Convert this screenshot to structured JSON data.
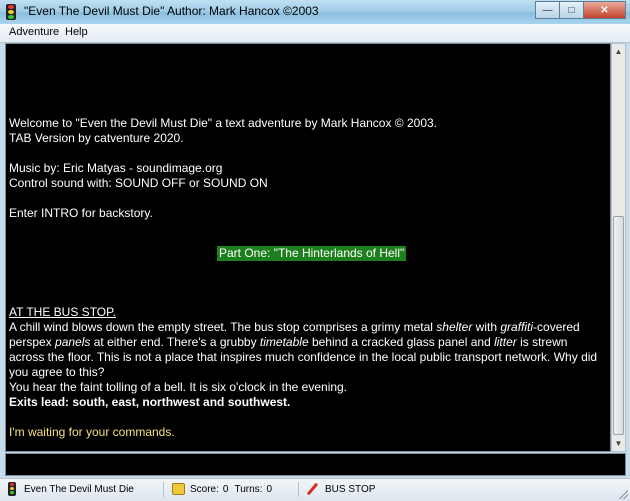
{
  "window": {
    "title": "\"Even The Devil Must Die\" Author: Mark Hancox ©2003",
    "minimize_glyph": "—",
    "maximize_glyph": "□",
    "close_glyph": "✕"
  },
  "menu": [
    {
      "label": "Adventure"
    },
    {
      "label": "Help"
    }
  ],
  "output": {
    "welcome_line1": "Welcome to \"Even the Devil Must Die\" a text adventure by Mark Hancox © 2003.",
    "welcome_line2": "TAB Version by catventure 2020.",
    "music_line1": "Music by: Eric Matyas - soundimage.org",
    "music_line2": "Control sound with: SOUND OFF or SOUND ON",
    "intro_line": "Enter INTRO for backstory.",
    "part_banner": "Part One: \"The Hinterlands of Hell\"",
    "location_header": "AT THE BUS STOP.",
    "description": [
      {
        "text": "A chill wind blows down the empty street. The bus stop comprises a grimy metal ",
        "i": false
      },
      {
        "text": "shelter",
        "i": true
      },
      {
        "text": " with ",
        "i": false
      },
      {
        "text": "graffiti",
        "i": true
      },
      {
        "text": "-covered perspex ",
        "i": false
      },
      {
        "text": "panels",
        "i": true
      },
      {
        "text": " at either end. There's a grubby ",
        "i": false
      },
      {
        "text": "timetable",
        "i": true
      },
      {
        "text": " behind a cracked glass panel and ",
        "i": false
      },
      {
        "text": "litter",
        "i": true
      },
      {
        "text": " is strewn across the floor. This is not a place that inspires much confidence in the local public transport network. Why did you agree to this?",
        "i": false
      }
    ],
    "bell_line": "You hear the faint tolling of a bell. It is six o'clock in the evening.",
    "exits_line": "Exits lead: south, east, northwest and southwest.",
    "prompt_line": "I'm waiting for your commands."
  },
  "command_input": {
    "value": "",
    "placeholder": ""
  },
  "status": {
    "game_name": "Even The Devil Must Die",
    "score_label": "Score:",
    "score_value": "0",
    "turns_label": "Turns:",
    "turns_value": "0",
    "location": "BUS STOP"
  },
  "colors": {
    "output_bg": "#000000",
    "output_text": "#ffffff",
    "banner_bg": "#1d7f1d",
    "prompt_text": "#f3e07e"
  }
}
